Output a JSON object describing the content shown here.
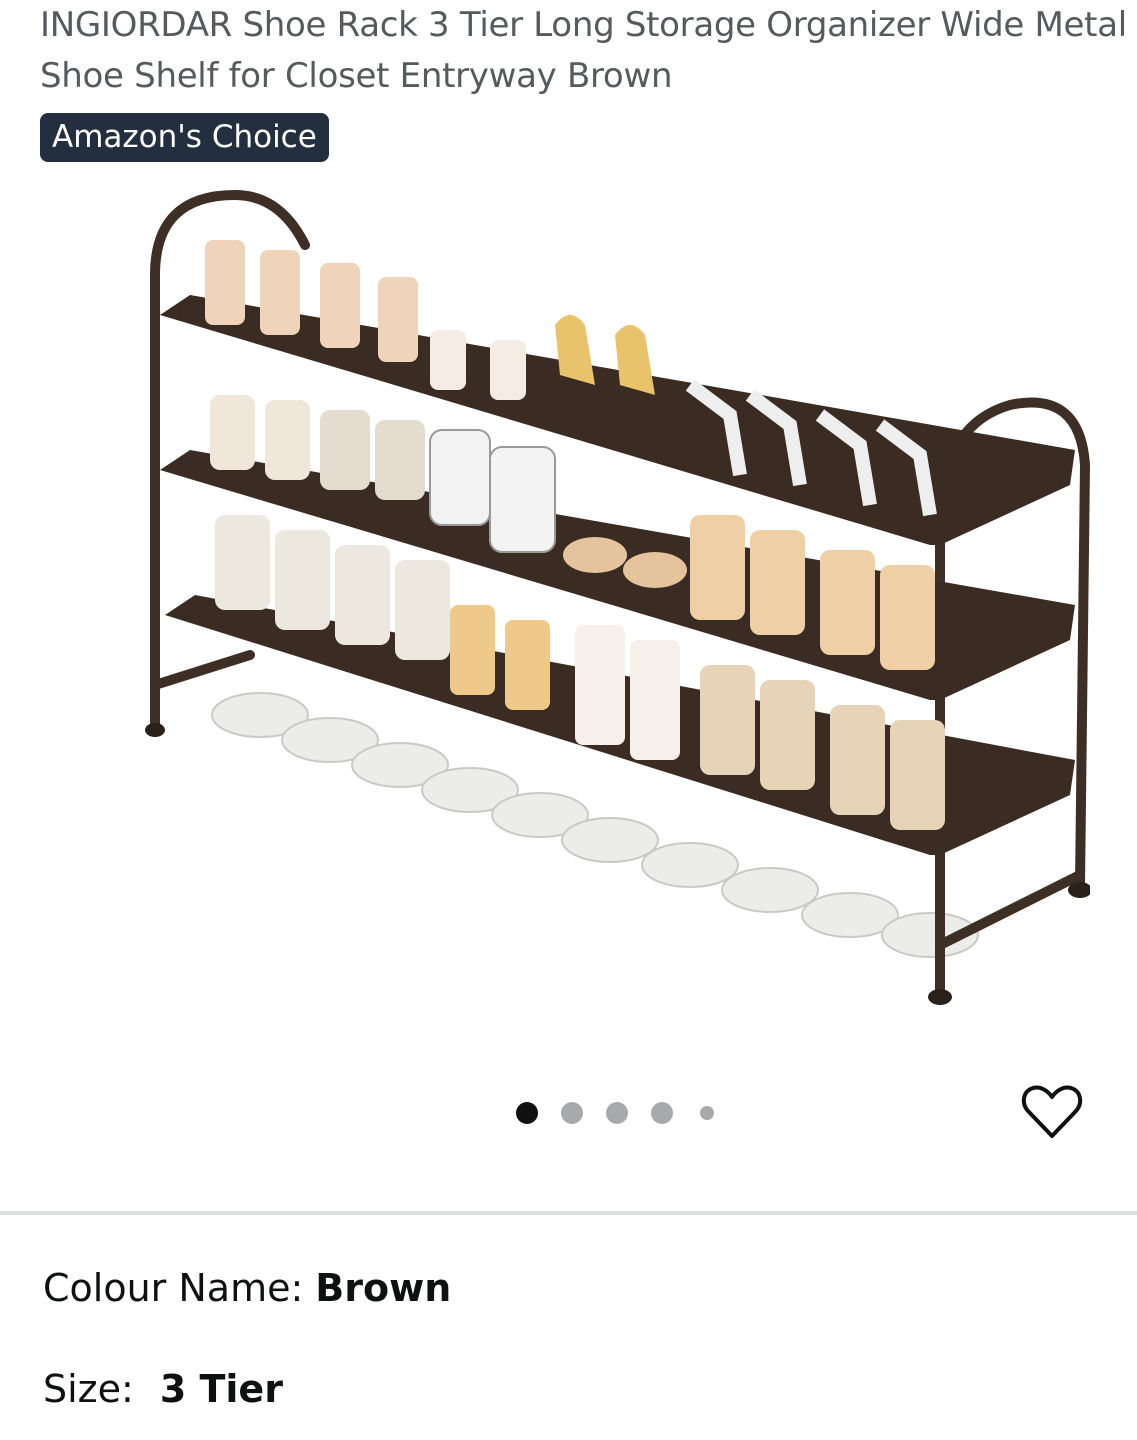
{
  "product": {
    "title": "INGIORDAR Shoe Rack 3 Tier Long Storage Organizer Wide Metal Shoe Shelf for Closet Entryway Brown",
    "badge": "Amazon's Choice"
  },
  "gallery": {
    "image_count": 5,
    "active_index": 0
  },
  "wishlist": {
    "icon": "heart-outline-icon"
  },
  "specs": {
    "colour_label": "Colour Name:",
    "colour_value": "Brown",
    "size_label": "Size:",
    "size_value": "3 Tier"
  },
  "colors": {
    "badge_bg": "#232f3e",
    "title_text": "#555a5c",
    "rack_metal": "#3d2f25",
    "divider": "#dcdedf"
  }
}
